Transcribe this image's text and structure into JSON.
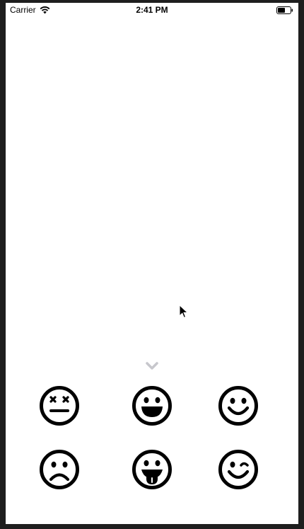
{
  "status_bar": {
    "carrier": "Carrier",
    "time": "2:41 PM",
    "wifi_icon": "wifi-icon",
    "battery_icon": "battery-icon"
  },
  "collapse_control": {
    "icon": "chevron-down-icon",
    "color": "#c7c7cc"
  },
  "emoji_grid": [
    {
      "name": "dizzy-face-icon"
    },
    {
      "name": "grinning-face-icon"
    },
    {
      "name": "smiling-face-icon"
    },
    {
      "name": "frowning-face-icon"
    },
    {
      "name": "tongue-out-face-icon"
    },
    {
      "name": "winking-face-icon"
    }
  ],
  "colors": {
    "background": "#ffffff",
    "frame": "#1e1e1e",
    "icon": "#000000"
  }
}
